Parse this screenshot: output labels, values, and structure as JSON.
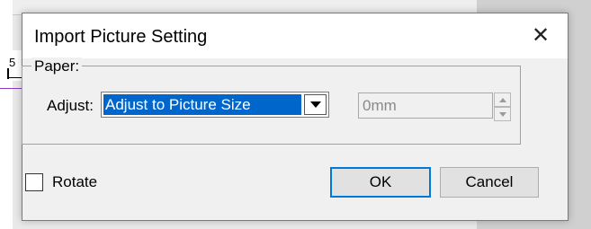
{
  "background": {
    "ruler_tick": "5"
  },
  "dialog": {
    "title": "Import Picture Setting",
    "close_glyph": "✕",
    "paper_group": {
      "legend": "Paper:",
      "adjust_label": "Adjust:",
      "adjust_selected": "Adjust to Picture Size",
      "size_value": "0mm"
    },
    "rotate": {
      "label": "Rotate",
      "checked": false
    },
    "ok_label": "OK",
    "cancel_label": "Cancel"
  },
  "colors": {
    "selection": "#0066cc",
    "default_button_border": "#0078d7"
  },
  "icons": [
    "close-icon",
    "chevron-down-icon",
    "spin-up-icon",
    "spin-down-icon"
  ]
}
